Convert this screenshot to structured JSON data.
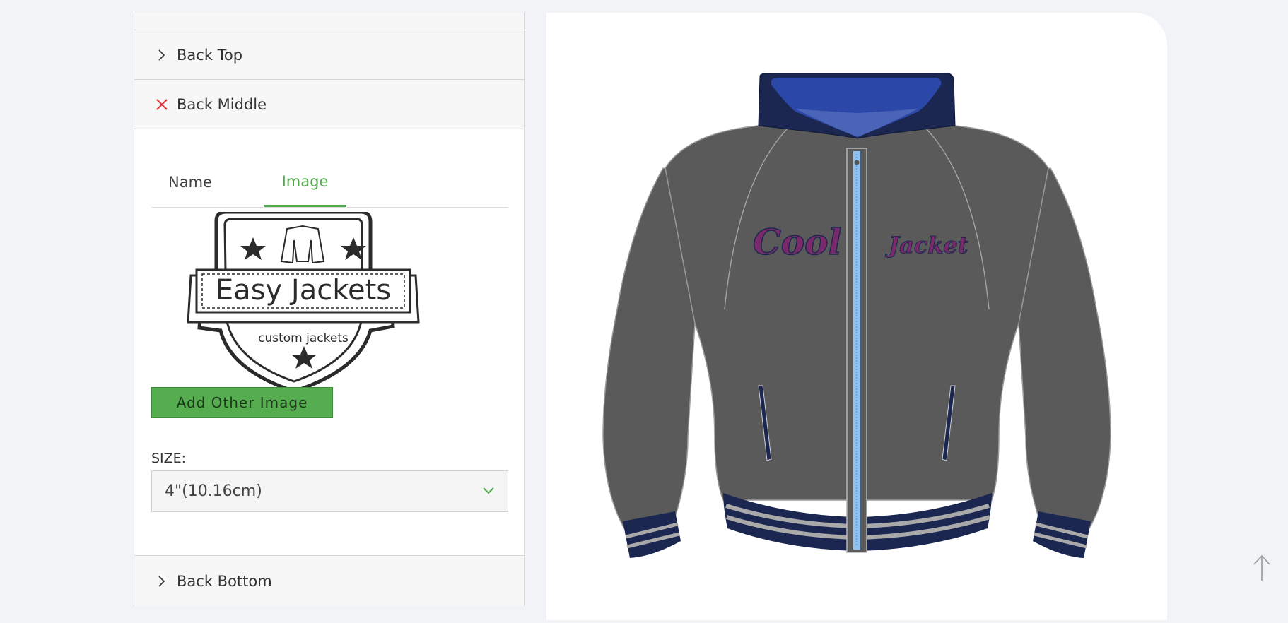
{
  "accordion": {
    "back_top": "Back Top",
    "back_middle": "Back Middle",
    "back_bottom": "Back Bottom"
  },
  "tabs": [
    {
      "label": "Name",
      "active": false
    },
    {
      "label": "Image",
      "active": true
    }
  ],
  "logo": {
    "brand": "Easy Jackets",
    "tagline": "custom jackets"
  },
  "add_image_button": "Add Other Image",
  "size": {
    "label": "SIZE:",
    "selected": "4\"(10.16cm)"
  },
  "jacket": {
    "text_left": "Cool",
    "text_right": "Jacket",
    "body_color": "#5a5a5a",
    "trim_color": "#1b2750",
    "hood_lining_color": "#2b48a8",
    "stripe_color": "#a9a9a9",
    "zipper_color": "#8ec3ef",
    "text_color": "#7a2a6a"
  },
  "colors": {
    "accent": "#4fa84a",
    "close_icon": "#d9343f"
  }
}
